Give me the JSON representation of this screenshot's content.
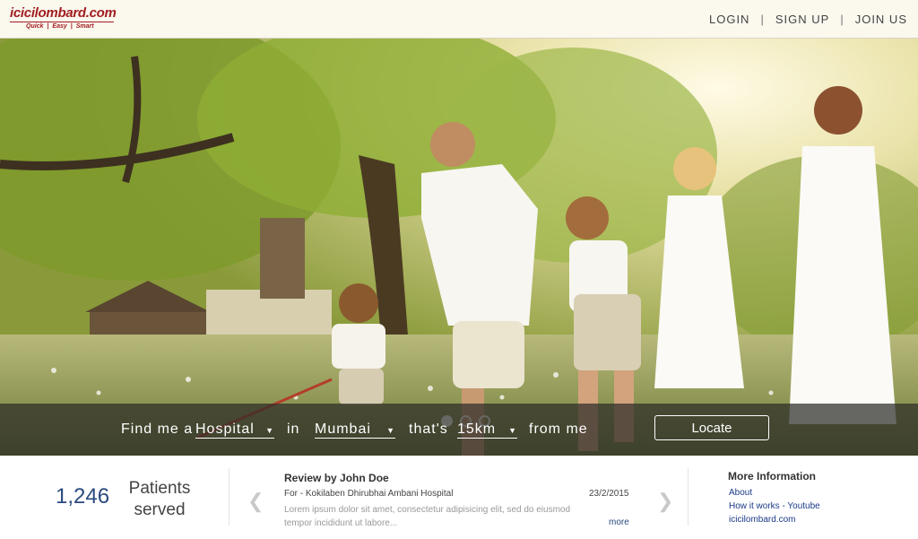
{
  "logo": {
    "name": "icicilombard.com",
    "tagline": [
      "Quick",
      "Easy",
      "Smart"
    ]
  },
  "nav": {
    "login": "LOGIN",
    "signup": "SIGN UP",
    "joinus": "JOIN US",
    "separator": "|"
  },
  "search": {
    "prefix": "Find me a",
    "facility": "Hospital",
    "in_label": "in",
    "city": "Mumbai",
    "thats_label": "that's",
    "distance": "15km",
    "suffix": "from me",
    "button": "Locate"
  },
  "carousel": {
    "slides": 3,
    "active": 1
  },
  "stats": {
    "count": "1,246",
    "label": "Patients served"
  },
  "review": {
    "title": "Review by John Doe",
    "for": "For - Kokilaben Dhirubhai Ambani Hospital",
    "date": "23/2/2015",
    "body": "Lorem ipsum dolor sit amet, consectetur adipisicing elit, sed do eiusmod tempor incididunt ut labore...",
    "more": "more"
  },
  "more_info": {
    "title": "More Information",
    "links": [
      "About",
      "How it works - Youtube",
      "icicilombard.com"
    ]
  },
  "colors": {
    "brand": "#a11d21",
    "accent": "#2a4a7f",
    "header_bg": "#fbf8ee"
  },
  "icons": {
    "prev": "chevron-left-icon",
    "next": "chevron-right-icon",
    "dropdown": "caret-down-icon"
  }
}
